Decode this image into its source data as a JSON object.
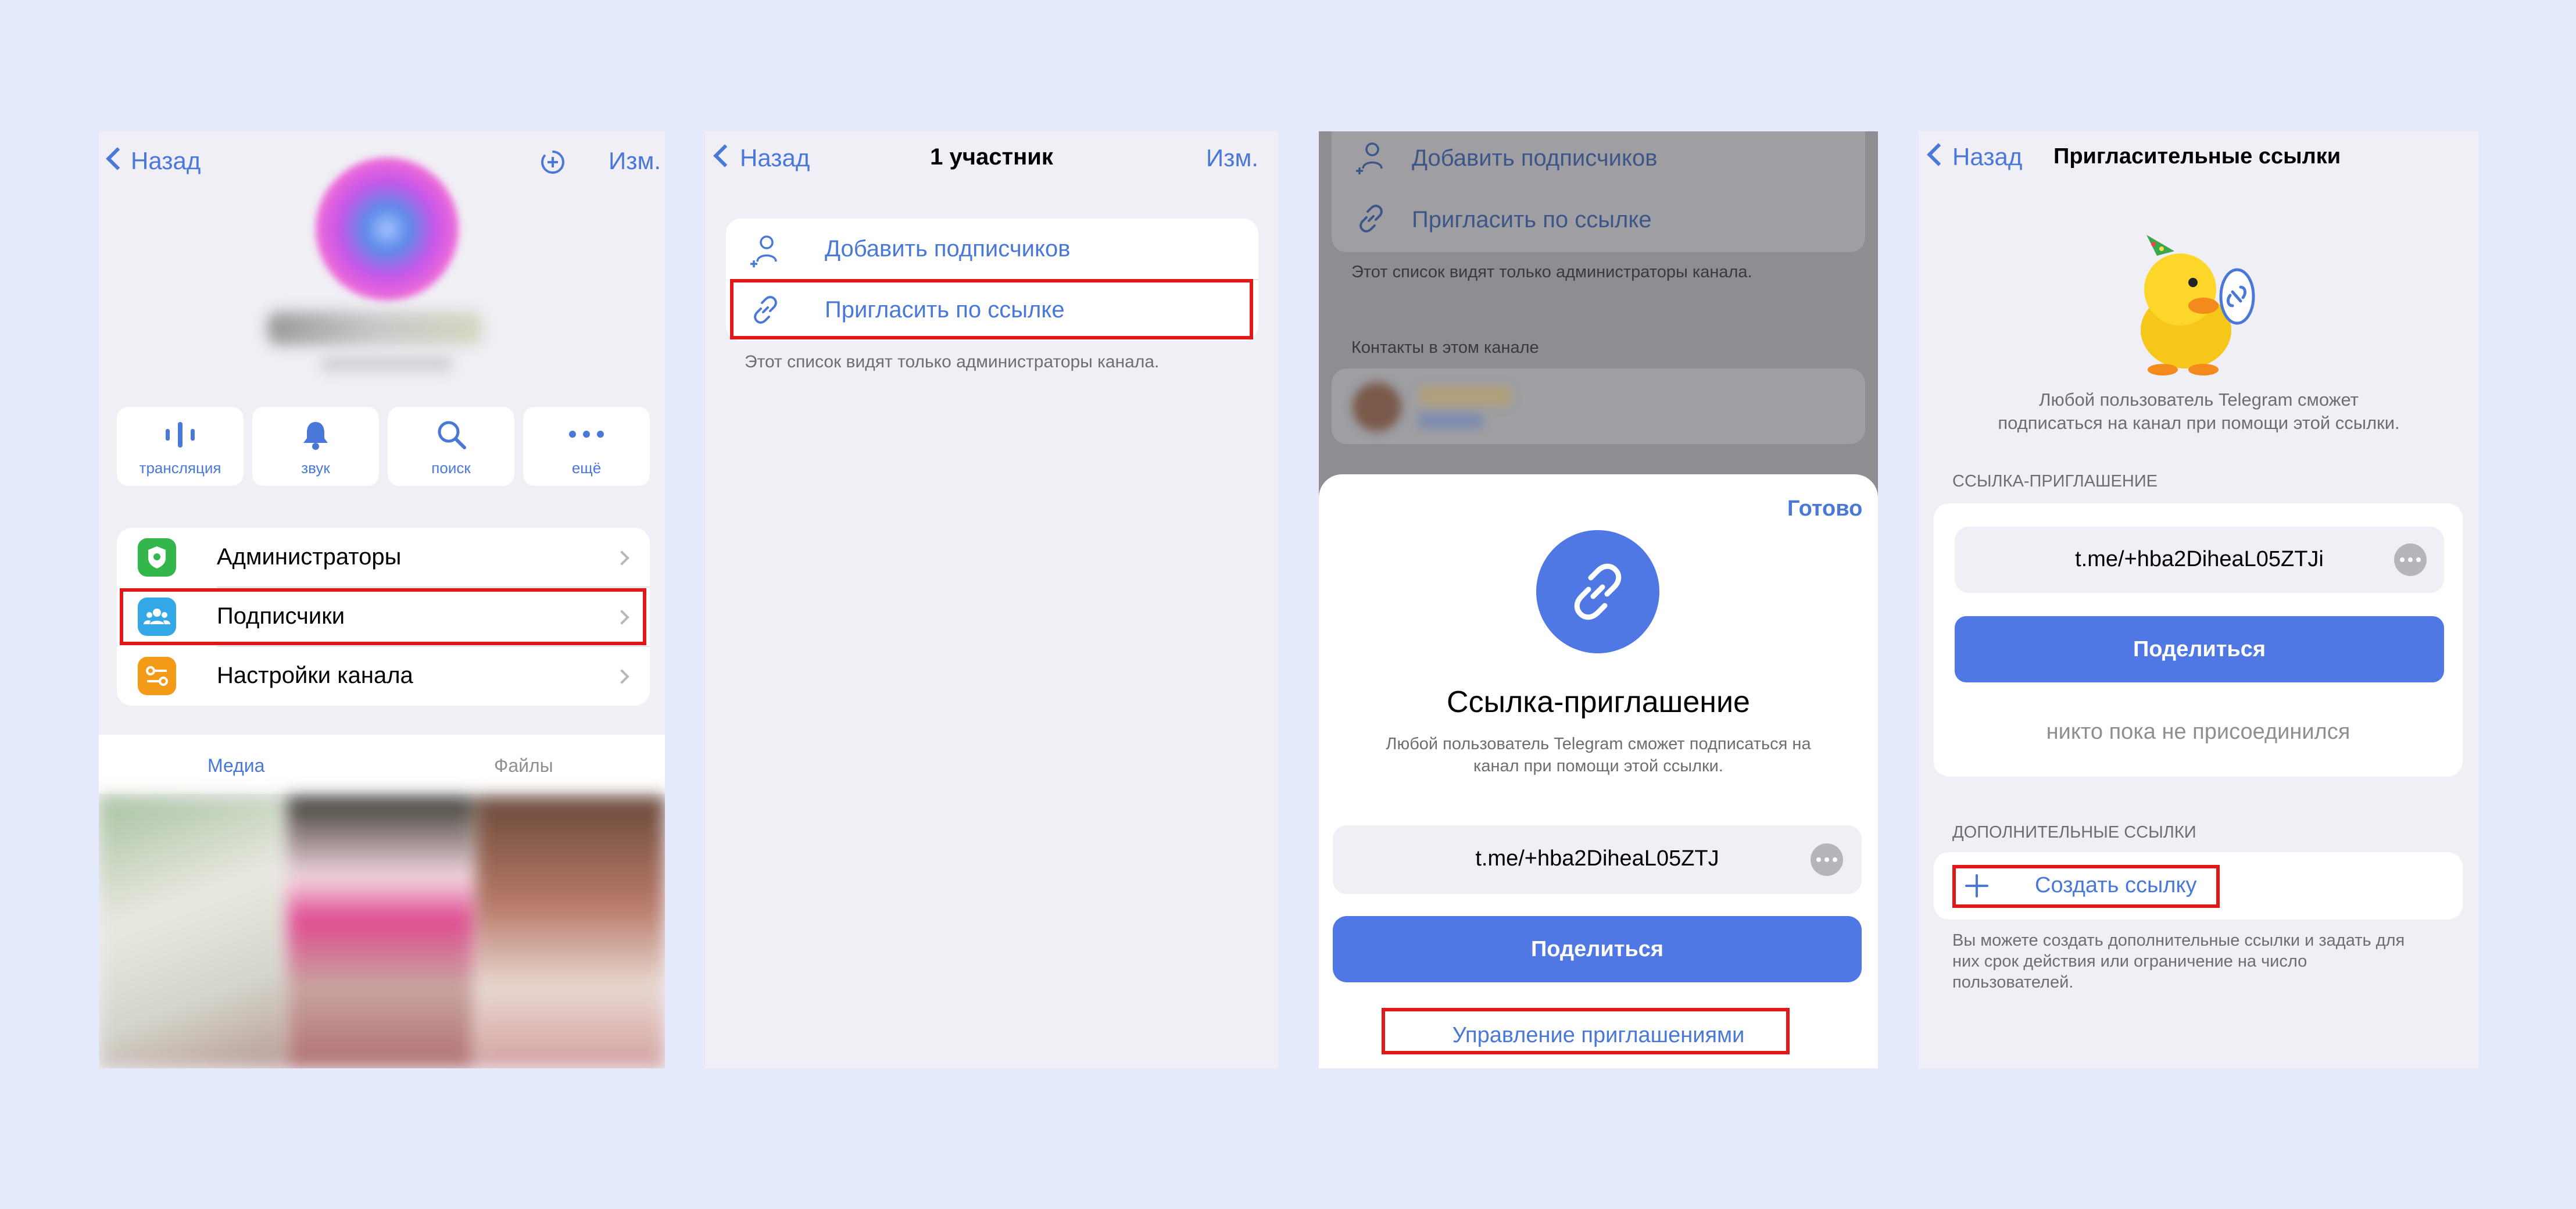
{
  "colors": {
    "accent": "#4a78d8",
    "button": "#5078e4",
    "highlight": "#e01818",
    "background": "#e4e9fb"
  },
  "s1": {
    "back": "Назад",
    "edit": "Изм.",
    "actions": [
      {
        "icon": "broadcast-icon",
        "label": "трансляция"
      },
      {
        "icon": "bell-icon",
        "label": "звук"
      },
      {
        "icon": "search-icon",
        "label": "поиск"
      },
      {
        "icon": "more-icon",
        "label": "ещё"
      }
    ],
    "menu": [
      {
        "icon": "admins-icon",
        "label": "Администраторы",
        "color": "#34b74a"
      },
      {
        "icon": "subscribers-icon",
        "label": "Подписчики",
        "color": "#32a8e6"
      },
      {
        "icon": "settings-icon",
        "label": "Настройки канала",
        "color": "#f39a16"
      }
    ],
    "tabs": {
      "media": "Медиа",
      "files": "Файлы"
    }
  },
  "s2": {
    "back": "Назад",
    "title": "1 участник",
    "edit": "Изм.",
    "add": "Добавить подписчиков",
    "invite": "Пригласить по ссылке",
    "note": "Этот список видят только администраторы канала."
  },
  "s3": {
    "add": "Добавить подписчиков",
    "invite": "Пригласить по ссылке",
    "note": "Этот список видят только администраторы канала.",
    "contacts_header": "Контакты в этом канале",
    "done": "Готово",
    "title": "Ссылка-приглашение",
    "desc1": "Любой пользователь Telegram сможет подписаться на",
    "desc2": "канал при помощи этой ссылки.",
    "link": "t.me/+hba2DiheaL05ZTJ",
    "share": "Поделиться",
    "manage": "Управление приглашениями"
  },
  "s4": {
    "back": "Назад",
    "title": "Пригласительные ссылки",
    "desc1": "Любой пользователь Telegram сможет",
    "desc2": "подписаться на канал при помощи этой ссылки.",
    "invite_header": "ССЫЛКА-ПРИГЛАШЕНИЕ",
    "link": "t.me/+hba2DiheaL05ZTJi",
    "share": "Поделиться",
    "nobody": "никто пока не присоединился",
    "extra_header": "ДОПОЛНИТЕЛЬНЫЕ ССЫЛКИ",
    "create": "Создать ссылку",
    "foot1": "Вы можете создать дополнительные ссылки и задать для",
    "foot2": "них срок действия или ограничение на число",
    "foot3": "пользователей."
  }
}
